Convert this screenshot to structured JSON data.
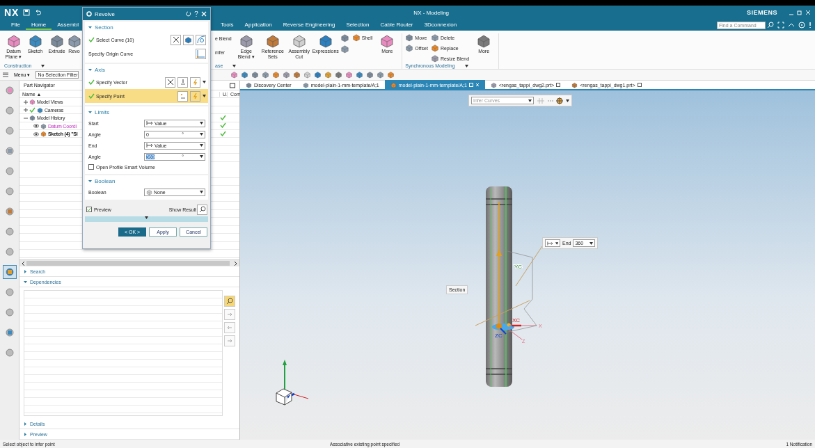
{
  "title_bar": {
    "logo": "NX",
    "title": "NX - Modeling",
    "brand": "SIEMENS"
  },
  "menu_tabs": [
    {
      "label": "File",
      "selected": false
    },
    {
      "label": "Home",
      "selected": true
    },
    {
      "label": "Assembl",
      "selected": false
    },
    {
      "label": "Tools",
      "selected": false
    },
    {
      "label": "Application",
      "selected": false
    },
    {
      "label": "Reverse Engineering",
      "selected": false
    },
    {
      "label": "Selection",
      "selected": false
    },
    {
      "label": "Cable Router",
      "selected": false
    },
    {
      "label": "3Dconnexion",
      "selected": false
    }
  ],
  "command_search": {
    "placeholder": "Find a Command"
  },
  "ribbon": {
    "groups": [
      {
        "label": "Construction",
        "menu": true,
        "items": [
          {
            "kind": "large",
            "label": "Datum Plane ▾"
          },
          {
            "kind": "large",
            "label": "Sketch"
          },
          {
            "kind": "large",
            "label": "Extrude"
          },
          {
            "kind": "large",
            "label": "Revo"
          }
        ]
      },
      {
        "label": "ase",
        "menu": true,
        "items": [
          {
            "kind": "labels",
            "items": [
              {
                "label": "e Blend"
              },
              {
                "label": "mfer"
              }
            ]
          },
          {
            "kind": "large",
            "label": "Edge Blend ▾"
          },
          {
            "kind": "large",
            "label": "Reference Sets"
          },
          {
            "kind": "large",
            "label": "Assembly Cut"
          },
          {
            "kind": "large",
            "label": "Expressions"
          },
          {
            "kind": "stack",
            "items": [
              {
                "kind": "icon"
              },
              {
                "kind": "icon"
              }
            ]
          },
          {
            "kind": "stack",
            "items": [
              {
                "label": "Shell"
              }
            ]
          },
          {
            "kind": "large",
            "label": "More"
          }
        ]
      },
      {
        "label": "Synchronous Modeling",
        "menu": true,
        "items": [
          {
            "kind": "stack",
            "items": [
              {
                "label": "Move"
              },
              {
                "label": "Offset"
              }
            ]
          },
          {
            "kind": "stack",
            "items": [
              {
                "label": "Delete"
              },
              {
                "label": "Replace"
              },
              {
                "label": "Resize Blend"
              }
            ]
          },
          {
            "kind": "large",
            "label": "More"
          }
        ]
      }
    ]
  },
  "toolbar": {
    "menu": "Menu ▾",
    "filter": "No Selection Filter"
  },
  "doc_tabs": [
    {
      "label": "Discovery Center",
      "selected": false
    },
    {
      "label": "model-plain-1-mm-template/A;1",
      "selected": false
    },
    {
      "label": "model-plain-1-mm-template/A;1",
      "selected": true
    },
    {
      "label": "<rengas_tappi_dwg2.prt>",
      "selected": false
    },
    {
      "label": "<rengas_tappi_dwg1.prt>",
      "selected": false
    }
  ],
  "resource_bar": [
    {
      "selected": false
    },
    {
      "selected": false
    },
    {
      "selected": false
    },
    {
      "selected": false
    },
    {
      "selected": false
    },
    {
      "selected": false
    },
    {
      "selected": false
    },
    {
      "selected": false
    },
    {
      "selected": false
    },
    {
      "selected": true
    },
    {
      "selected": false
    },
    {
      "selected": false
    },
    {
      "selected": false
    },
    {
      "selected": false
    }
  ],
  "navigator": {
    "title": "Part Navigator",
    "columns": [
      "Name ▲",
      "U.",
      "Com"
    ],
    "tree": [
      {
        "label": "Model Views",
        "expanded": false,
        "checked": false
      },
      {
        "label": "Cameras",
        "expanded": false,
        "checked": true
      },
      {
        "label": "Model History",
        "expanded": true,
        "up_to_date": true,
        "children": [
          {
            "label": "Datum Coordi",
            "up_to_date": true,
            "kind": "datum"
          },
          {
            "label": "Sketch (4) \"Sl",
            "up_to_date": true,
            "kind": "sketch"
          }
        ]
      }
    ],
    "panels": [
      {
        "label": "Search",
        "expanded": false
      },
      {
        "label": "Dependencies",
        "expanded": true
      },
      {
        "label": "Details",
        "expanded": false
      },
      {
        "label": "Preview",
        "expanded": false
      }
    ]
  },
  "dialog": {
    "title": "Revolve",
    "section": {
      "title": "Section",
      "rows": [
        {
          "label": "Select Curve (10)",
          "done": true
        },
        {
          "label": "Specify Origin Curve",
          "done": false
        }
      ]
    },
    "axis": {
      "title": "Axis",
      "rows": [
        {
          "label": "Specify Vector",
          "done": true,
          "selected": false
        },
        {
          "label": "Specify Point",
          "done": true,
          "selected": true
        }
      ]
    },
    "limits": {
      "title": "Limits",
      "rows": [
        {
          "label": "Start",
          "kind": "option",
          "value": "Value"
        },
        {
          "label": "Angle",
          "kind": "number",
          "value": "0",
          "unit": "°",
          "highlighted": false
        },
        {
          "label": "End",
          "kind": "option",
          "value": "Value"
        },
        {
          "label": "Angle",
          "kind": "number",
          "value": "360",
          "unit": "°",
          "highlighted": true
        }
      ],
      "open_profile": {
        "label": "Open Profile Smart Volume",
        "checked": false
      }
    },
    "boolean": {
      "title": "Boolean",
      "label": "Boolean",
      "value": "None"
    },
    "preview": {
      "label": "Preview",
      "checked": true
    },
    "show_result": "Show Result",
    "buttons": [
      {
        "label": "< OK >",
        "primary": true
      },
      {
        "label": "Apply",
        "primary": false
      },
      {
        "label": "Cancel",
        "primary": false
      }
    ]
  },
  "viewport": {
    "infer": "Infer Curves",
    "section_label": "Section",
    "end_label": "End",
    "end_value": "360",
    "axis_labels": [
      "YC",
      "XC",
      "ZC",
      "X",
      "Z"
    ]
  },
  "status_bar": {
    "prompt": "Select object to infer point",
    "message": "Associative existing point specified",
    "notifications": "1 Notification"
  }
}
